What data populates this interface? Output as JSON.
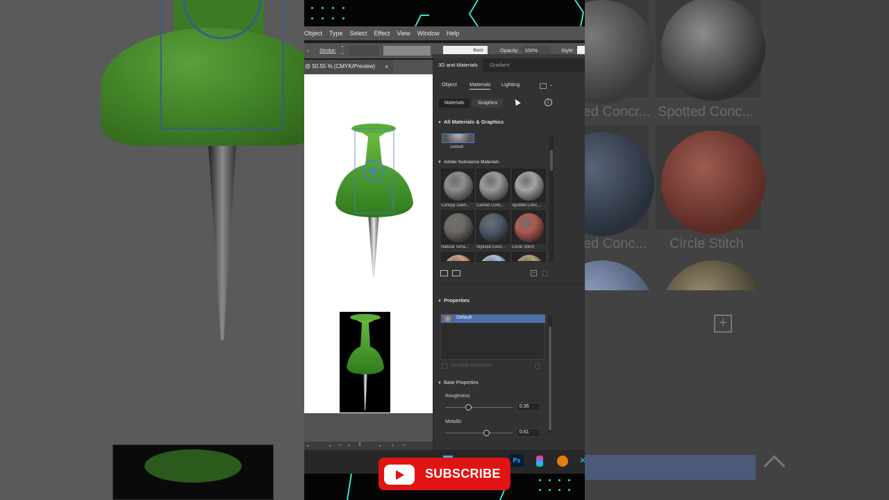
{
  "menu": [
    "Object",
    "Type",
    "Select",
    "Effect",
    "View",
    "Window",
    "Help"
  ],
  "control_bar": {
    "stroke_label": "Stroke:",
    "opacity_label": "Opacity:",
    "opacity_value": "100%",
    "style_label": "Style:",
    "brush_label": "Basic"
  },
  "document_tab": {
    "title": "@ 50.55 % (CMYK/Preview)",
    "close": "×"
  },
  "status_bar": {
    "page": "1"
  },
  "panel": {
    "tabs": [
      "3D and Materials",
      "Gradient"
    ],
    "subtabs": [
      "Object",
      "Materials",
      "Lighting"
    ],
    "segments": [
      "Materials",
      "Graphics"
    ],
    "info_icon": "i",
    "all_section": "All Materials & Graphics",
    "default_label": "Default",
    "substance_section": "Adobe Substance Materials",
    "materials": [
      {
        "label": "Canopy Diam...",
        "color": "#8e8e8e"
      },
      {
        "label": "Carved Conc...",
        "color": "#9a9a9a"
      },
      {
        "label": "Spotted Conc...",
        "color": "#a5a5a5"
      },
      {
        "label": "Natural Terra...",
        "color": "#6e6a64"
      },
      {
        "label": "Stylized Conc...",
        "color": "#4f5c6e"
      },
      {
        "label": "Circle Stitch",
        "color": "#b05a50"
      }
    ],
    "properties_section": "Properties",
    "properties_item": "Default",
    "invisible_geometry": "Invisible Geometry",
    "base_properties": "Base Properties",
    "roughness_label": "Roughness",
    "roughness_value": "0.35",
    "roughness": 0.35,
    "metallic_label": "Metallic",
    "metallic_value": "0.61",
    "metallic": 0.61
  },
  "background_right_labels": [
    "Spotted Conc...",
    "Circle Stitch",
    "ted Concr...",
    "ed Conc..."
  ],
  "subscribe": "SUBSCRIBE",
  "colors": {
    "accent": "#e01414",
    "pin_green": "#4a9a2e",
    "panel_bg": "#323232",
    "neon": "#35e6d0"
  }
}
